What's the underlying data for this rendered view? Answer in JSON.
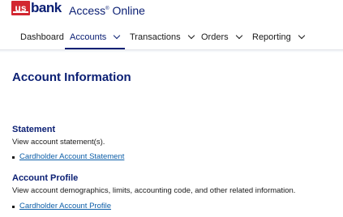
{
  "brand": {
    "logo_us": "us",
    "logo_bank": "bank",
    "app_title": "Access",
    "app_title_mark": "®",
    "app_subtitle": "Online"
  },
  "nav": {
    "items": [
      {
        "label": "Dashboard"
      },
      {
        "label": "Accounts"
      },
      {
        "label": "Transactions"
      },
      {
        "label": "Orders"
      },
      {
        "label": "Reporting"
      }
    ],
    "active": "Accounts"
  },
  "page": {
    "title": "Account Information"
  },
  "sections": [
    {
      "heading": "Statement",
      "description": "View account statement(s).",
      "link": "Cardholder Account Statement"
    },
    {
      "heading": "Account Profile",
      "description": "View account demographics, limits, accounting code, and other related information.",
      "link": "Cardholder Account Profile"
    }
  ],
  "colors": {
    "brand_navy": "#0c2074",
    "brand_red": "#d22630",
    "link_blue": "#0c5ea8"
  }
}
